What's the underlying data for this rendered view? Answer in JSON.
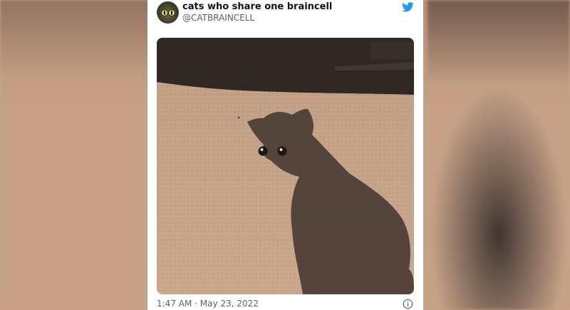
{
  "tweet": {
    "user_name": "cats who share one braincell",
    "user_handle": "@CATBRAINCELL",
    "timestamp": "1:47 AM · May 23, 2022"
  },
  "icons": {
    "brand": "twitter-bird-icon",
    "info": "info-icon"
  },
  "colors": {
    "twitter_blue": "#1d9bf0",
    "name_text": "#0f1419",
    "secondary_text": "#536471"
  }
}
